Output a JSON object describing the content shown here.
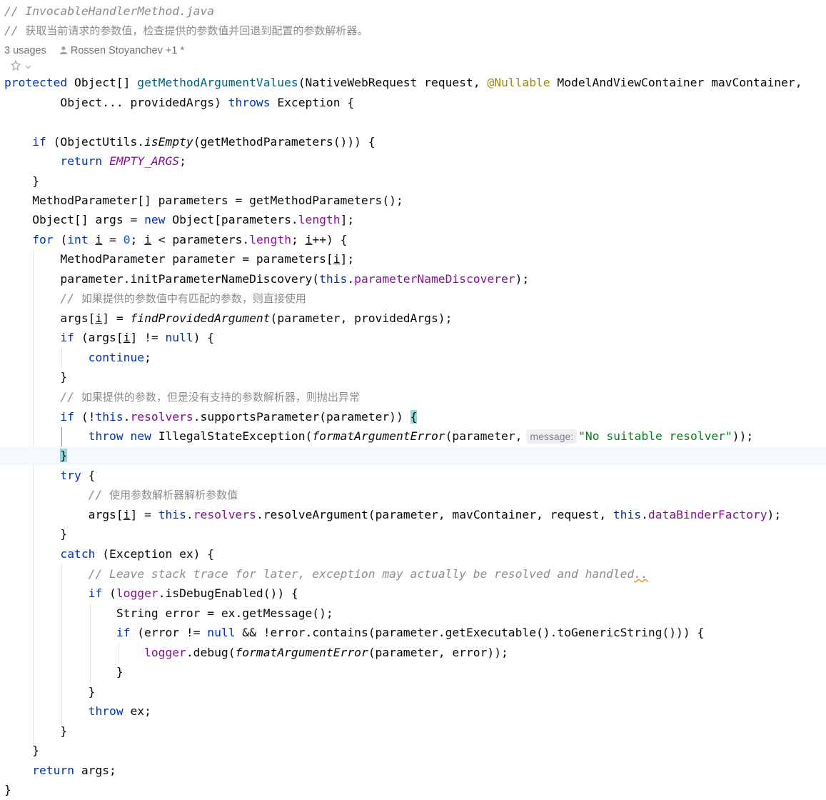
{
  "header_comments": {
    "file": "// InvocableHandlerMethod.java",
    "summary_prefix": "// ",
    "summary": "获取当前请求的参数值，检查提供的参数值并回退到配置的参数解析器。"
  },
  "meta": {
    "usages": "3 usages",
    "authors": "Rossen Stoyanchev +1 *"
  },
  "icons": {
    "person": "person-icon",
    "ai_assist": "ai-assist-icon",
    "chevron": "chevron-down-icon"
  },
  "colors": {
    "keyword": "#0033b3",
    "field": "#871094",
    "number": "#1750eb",
    "string": "#067d17",
    "annotation": "#9e880d",
    "comment": "#8c8c8c",
    "brace_highlight": "#93d9d9",
    "caret_row": "#f5f8fe"
  },
  "code": {
    "sig1": {
      "protected": "protected",
      "ret": " Object[] ",
      "name": "getMethodArgumentValues",
      "p1": "(NativeWebRequest request, ",
      "ann": "@Nullable",
      "p2": " ModelAndViewContainer mavContainer,"
    },
    "sig2": {
      "indent": "        ",
      "p": "Object... providedArgs) ",
      "throws": "throws",
      "exc": " Exception {"
    },
    "l4": {
      "indent": "    ",
      "if": "if",
      "a": " (ObjectUtils.",
      "isEmpty": "isEmpty",
      "b": "(getMethodParameters())) {"
    },
    "l5": {
      "indent": "        ",
      "return": "return",
      "sp": " ",
      "const": "EMPTY_ARGS",
      "semi": ";"
    },
    "l6": {
      "text": "    }"
    },
    "l7": {
      "text": "    MethodParameter[] parameters = getMethodParameters();"
    },
    "l8": {
      "indent": "    ",
      "a": "Object[] args = ",
      "new": "new",
      "b": " Object[parameters.",
      "length": "length",
      "c": "];"
    },
    "l9": {
      "indent": "    ",
      "for": "for",
      "a": " (",
      "int": "int",
      "sp": " ",
      "i1": "i",
      "eq": " = ",
      "zero": "0",
      "semi": "; ",
      "i2": "i",
      "lt": " < parameters.",
      "length": "length",
      "semi2": "; ",
      "i3": "i",
      "inc": "++) {"
    },
    "l10": {
      "indent": "        ",
      "a": "MethodParameter parameter = parameters[",
      "i": "i",
      "b": "];"
    },
    "l11": {
      "indent": "        ",
      "a": "parameter.initParameterNameDiscovery(",
      "this": "this",
      "dot": ".",
      "field": "parameterNameDiscoverer",
      "b": ");"
    },
    "l12": {
      "indent": "        ",
      "slashes": "// ",
      "text": "如果提供的参数值中有匹配的参数，则直接使用"
    },
    "l13": {
      "indent": "        ",
      "a": "args[",
      "i": "i",
      "b": "] = ",
      "fn": "findProvidedArgument",
      "c": "(parameter, providedArgs);"
    },
    "l14": {
      "indent": "        ",
      "if": "if",
      "a": " (args[",
      "i": "i",
      "b": "] != ",
      "null": "null",
      "c": ") {"
    },
    "l15": {
      "indent": "            ",
      "continue": "continue",
      "semi": ";"
    },
    "l16": {
      "text": "        }"
    },
    "l17": {
      "indent": "        ",
      "slashes": "// ",
      "text": "如果提供的参数，但是没有支持的参数解析器，则抛出异常"
    },
    "l18": {
      "indent": "        ",
      "if": "if",
      "a": " (!",
      "this": "this",
      "dot": ".",
      "field": "resolvers",
      "b": ".supportsParameter(parameter)) ",
      "brace": "{"
    },
    "l19": {
      "indent": "            ",
      "throw": "throw",
      "sp": " ",
      "new": "new",
      "a": " IllegalStateException(",
      "fn": "formatArgumentError",
      "b": "(parameter,",
      "hint": "message:",
      "str": "\"No suitable resolver\"",
      "c": "));"
    },
    "l20": {
      "indent": "        ",
      "brace": "}"
    },
    "l21": {
      "indent": "        ",
      "try": "try",
      "a": " {"
    },
    "l22": {
      "indent": "            ",
      "slashes": "// ",
      "text": "使用参数解析器解析参数值"
    },
    "l23": {
      "indent": "            ",
      "a": "args[",
      "i": "i",
      "b": "] = ",
      "this1": "this",
      "dot1": ".",
      "field1": "resolvers",
      "c": ".resolveArgument(parameter, mavContainer, request, ",
      "this2": "this",
      "dot2": ".",
      "field2": "dataBinderFactory",
      "d": ");"
    },
    "l24": {
      "text": "        }"
    },
    "l25": {
      "indent": "        ",
      "catch": "catch",
      "a": " (Exception ex) {"
    },
    "l26": {
      "indent": "            ",
      "text": "// Leave stack trace for later, exception may actually be resolved and handled",
      "dots": ".."
    },
    "l27": {
      "indent": "            ",
      "if": "if",
      "a": " (",
      "logger": "logger",
      "b": ".isDebugEnabled()) {"
    },
    "l28": {
      "text": "                String error = ex.getMessage();"
    },
    "l29": {
      "indent": "                ",
      "if": "if",
      "a": " (error != ",
      "null": "null",
      "b": " && !error.contains(parameter.getExecutable().toGenericString())) {"
    },
    "l30": {
      "indent": "                    ",
      "logger": "logger",
      "a": ".debug(",
      "fn": "formatArgumentError",
      "b": "(parameter, error));"
    },
    "l31": {
      "text": "                }"
    },
    "l32": {
      "text": "            }"
    },
    "l33": {
      "indent": "            ",
      "throw": "throw",
      "a": " ex;"
    },
    "l34": {
      "text": "        }"
    },
    "l35": {
      "text": "    }"
    },
    "l36": {
      "indent": "    ",
      "return": "return",
      "a": " args;"
    },
    "l37": {
      "text": "}"
    }
  }
}
